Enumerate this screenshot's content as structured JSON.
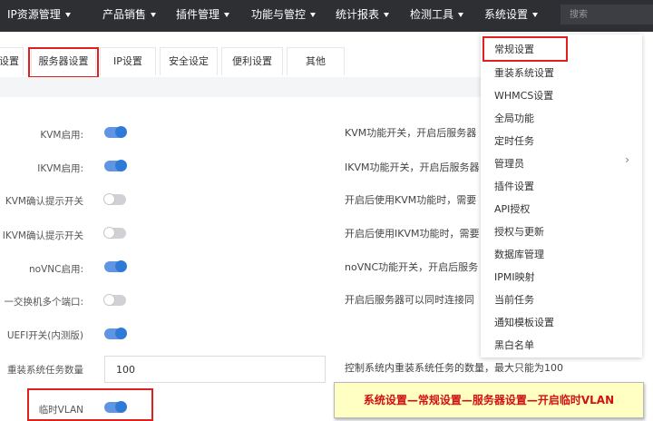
{
  "nav": {
    "items": [
      {
        "label": "IP资源管理"
      },
      {
        "label": "产品销售"
      },
      {
        "label": "插件管理"
      },
      {
        "label": "功能与管控"
      },
      {
        "label": "统计报表"
      },
      {
        "label": "检测工具"
      },
      {
        "label": "系统设置"
      }
    ],
    "search_placeholder": "搜索"
  },
  "tabs": [
    {
      "label": "设置"
    },
    {
      "label": "服务器设置"
    },
    {
      "label": "IP设置"
    },
    {
      "label": "安全设定"
    },
    {
      "label": "便利设置"
    },
    {
      "label": "其他"
    }
  ],
  "settings": [
    {
      "label": "KVM启用:",
      "type": "switch",
      "on": true,
      "desc": "KVM功能开关，开启后服务器"
    },
    {
      "label": "IKVM启用:",
      "type": "switch",
      "on": true,
      "desc": "IKVM功能开关，开启后服务器"
    },
    {
      "label": "KVM确认提示开关",
      "type": "switch",
      "on": false,
      "desc": "开启后使用KVM功能时，需要"
    },
    {
      "label": "IKVM确认提示开关",
      "type": "switch",
      "on": false,
      "desc": "开启后使用IKVM功能时，需要"
    },
    {
      "label": "noVNC启用:",
      "type": "switch",
      "on": true,
      "desc": "noVNC功能开关，开启后服务"
    },
    {
      "label": "一交换机多个端口:",
      "type": "switch",
      "on": false,
      "desc": "开启后服务器可以同时连接同"
    },
    {
      "label": "UEFI开关(内测版)",
      "type": "switch",
      "on": true,
      "desc": ""
    },
    {
      "label": "重装系统任务数量",
      "type": "input",
      "value": "100",
      "desc": "控制系统内重装系统任务的数量，最大只能为100"
    },
    {
      "label": "临时VLAN",
      "type": "switch",
      "on": true,
      "desc": ""
    }
  ],
  "dropdown": {
    "items": [
      {
        "label": "常规设置"
      },
      {
        "label": "重装系统设置"
      },
      {
        "label": "WHMCS设置"
      },
      {
        "label": "全局功能"
      },
      {
        "label": "定时任务"
      },
      {
        "label": "管理员",
        "submenu": true
      },
      {
        "label": "插件设置"
      },
      {
        "label": "API授权"
      },
      {
        "label": "授权与更新"
      },
      {
        "label": "数据库管理"
      },
      {
        "label": "IPMI映射"
      },
      {
        "label": "当前任务"
      },
      {
        "label": "通知模板设置"
      },
      {
        "label": "黑白名单"
      }
    ]
  },
  "tip": {
    "text": "系统设置—常规设置—服务器设置—开启临时VLAN"
  },
  "colors": {
    "nav_bg": "#2d2f33",
    "switch_on": "#2f7ad7",
    "highlight": "#e02020",
    "tip_bg": "#ffffc4",
    "tip_text": "#d11111"
  }
}
